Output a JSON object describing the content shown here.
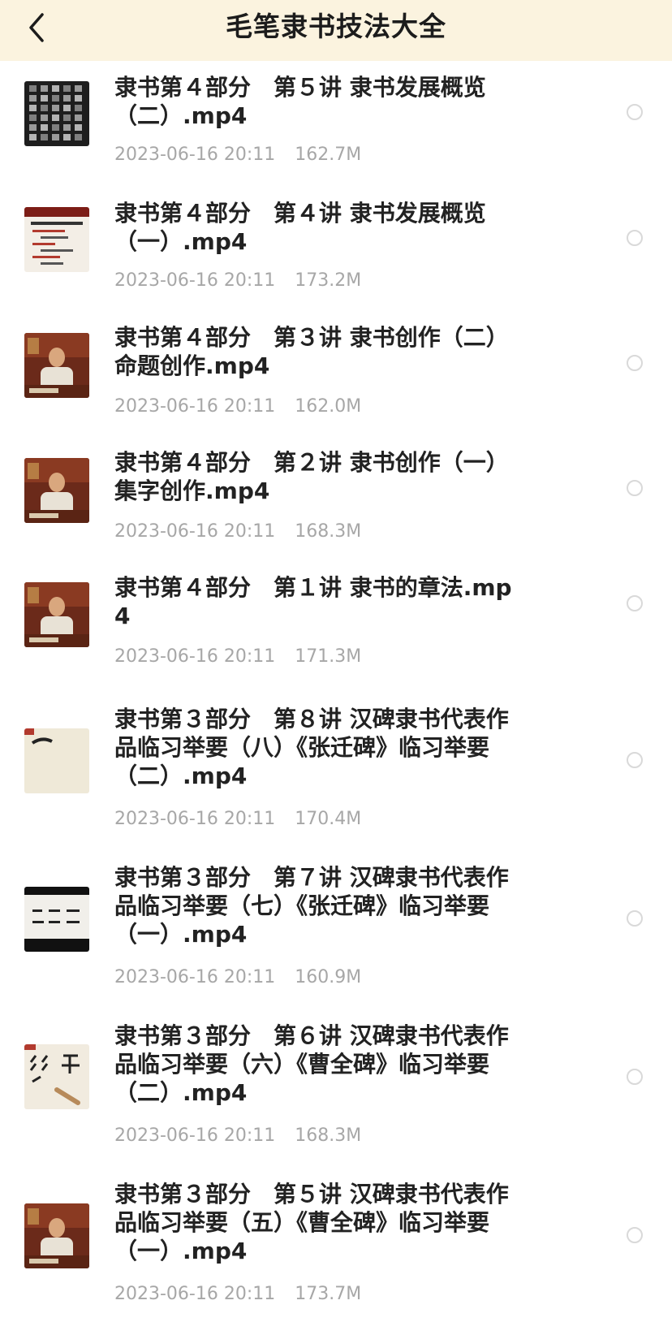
{
  "header": {
    "title": "毛笔隶书技法大全",
    "back_icon": "chevron-left-icon"
  },
  "colors": {
    "header_bg": "#fbf3df",
    "title_text": "#1c1c1c",
    "file_name_text": "#222222",
    "meta_text": "#a7a7a7",
    "radio_border": "#d9d9d9"
  },
  "files": [
    {
      "name": "隶书第４部分　第５讲 隶书发展概览（二）.mp4",
      "date": "2023-06-16 20:11",
      "size": "162.7M",
      "thumb": "calligraphy-rubbing"
    },
    {
      "name": "隶书第４部分　第４讲 隶书发展概览（一）.mp4",
      "date": "2023-06-16 20:11",
      "size": "173.2M",
      "thumb": "slide-text"
    },
    {
      "name": "隶书第４部分　第３讲 隶书创作（二）命题创作.mp4",
      "date": "2023-06-16 20:11",
      "size": "162.0M",
      "thumb": "lecturer"
    },
    {
      "name": "隶书第４部分　第２讲 隶书创作（一）集字创作.mp4",
      "date": "2023-06-16 20:11",
      "size": "168.3M",
      "thumb": "lecturer"
    },
    {
      "name": "隶书第４部分　第１讲 隶书的章法.mp4",
      "date": "2023-06-16 20:11",
      "size": "171.3M",
      "thumb": "lecturer"
    },
    {
      "name": "隶书第３部分　第８讲 汉碑隶书代表作品临习举要（八）《张迁碑》临习举要（二）.mp4",
      "date": "2023-06-16 20:11",
      "size": "170.4M",
      "thumb": "brush-paper"
    },
    {
      "name": "隶书第３部分　第７讲 汉碑隶书代表作品临习举要（七）《张迁碑》临习举要（一）.mp4",
      "date": "2023-06-16 20:11",
      "size": "160.9M",
      "thumb": "brush-strokes"
    },
    {
      "name": "隶书第３部分　第６讲 汉碑隶书代表作品临习举要（六）《曹全碑》临习举要（二）.mp4",
      "date": "2023-06-16 20:11",
      "size": "168.3M",
      "thumb": "characters-writing"
    },
    {
      "name": "隶书第３部分　第５讲 汉碑隶书代表作品临习举要（五）《曹全碑》临习举要（一）.mp4",
      "date": "2023-06-16 20:11",
      "size": "173.7M",
      "thumb": "lecturer"
    }
  ]
}
